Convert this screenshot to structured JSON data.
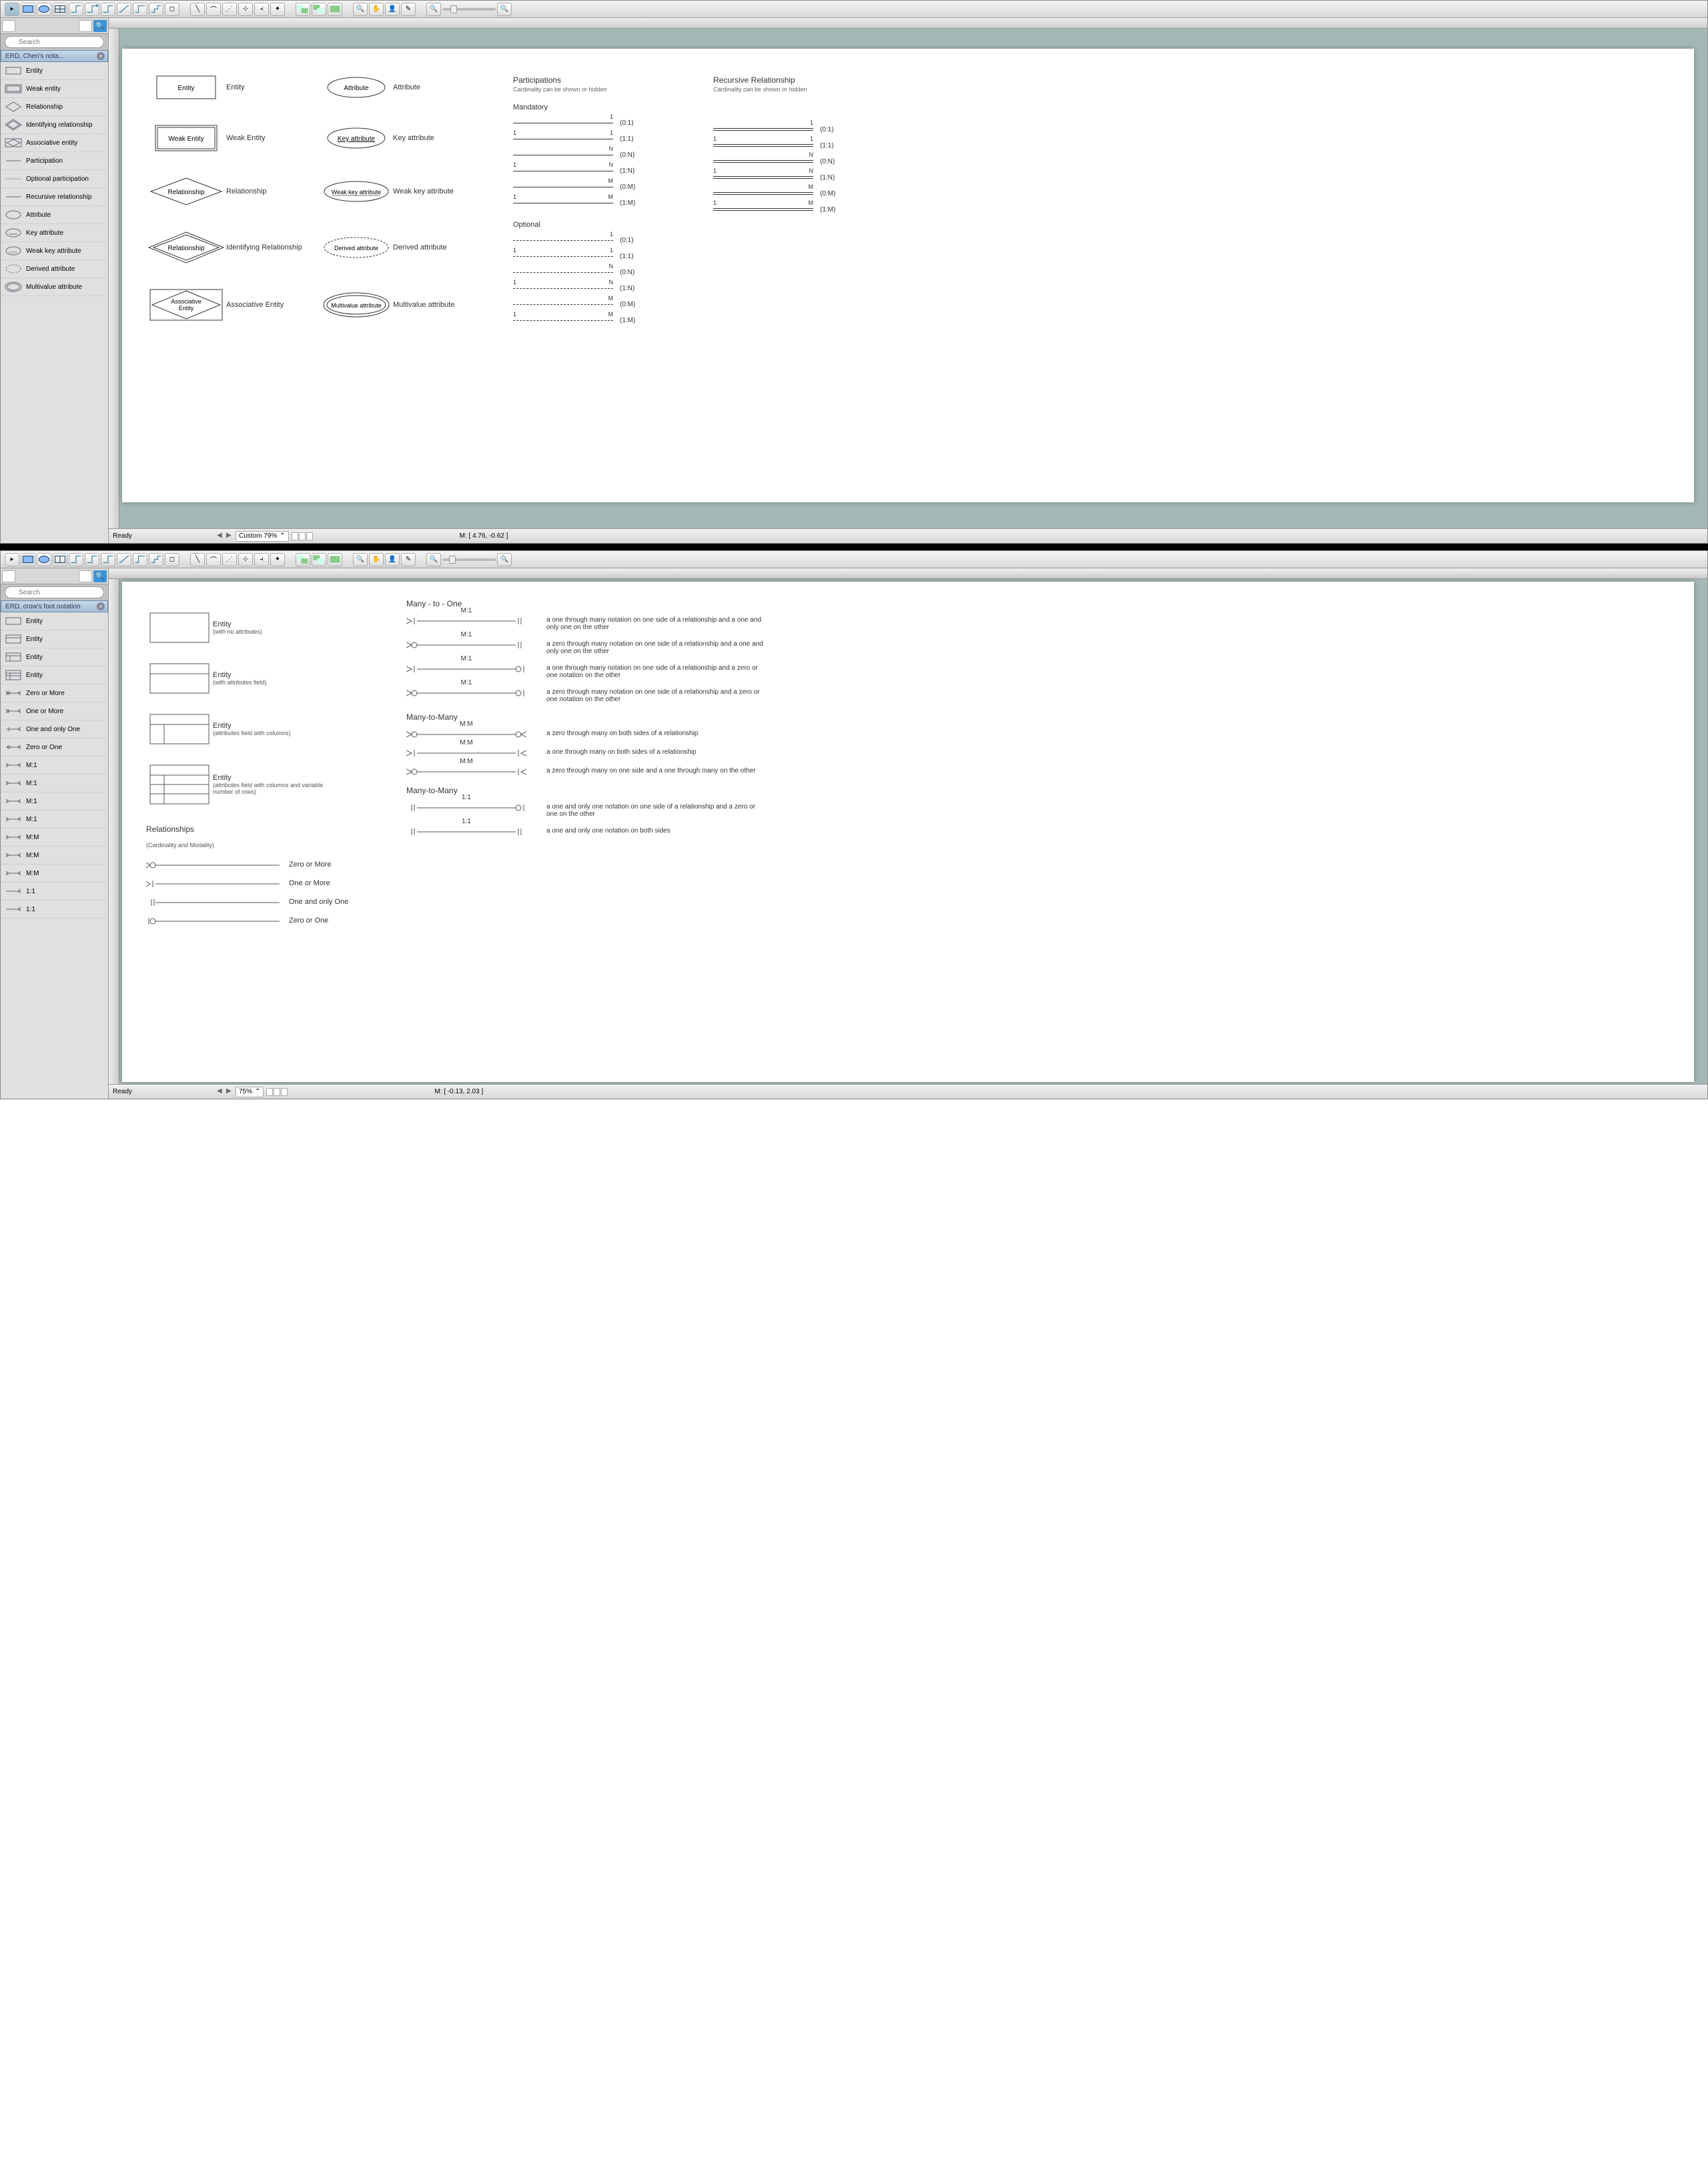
{
  "window1": {
    "search_placeholder": "Search",
    "library_title": "ERD, Chen's nota...",
    "library_items": [
      {
        "name": "Entity",
        "icon": "rect"
      },
      {
        "name": "Weak entity",
        "icon": "drect"
      },
      {
        "name": "Relationship",
        "icon": "diamond"
      },
      {
        "name": "Identifying relationship",
        "icon": "ddiamond"
      },
      {
        "name": "Associative entity",
        "icon": "assoc"
      },
      {
        "name": "Participation",
        "icon": "line"
      },
      {
        "name": "Optional participation",
        "icon": "dline"
      },
      {
        "name": "Recursive relationship",
        "icon": "line"
      },
      {
        "name": "Attribute",
        "icon": "ellipse"
      },
      {
        "name": "Key attribute",
        "icon": "ellipse-u"
      },
      {
        "name": "Weak key attribute",
        "icon": "ellipse-du"
      },
      {
        "name": "Derived attribute",
        "icon": "dellipse"
      },
      {
        "name": "Multivalue attribute",
        "icon": "dbl-ellipse"
      }
    ],
    "canvas": {
      "col1": [
        {
          "shape": "Entity",
          "label": "Entity"
        },
        {
          "shape": "Weak Entity",
          "label": "Weak Entity"
        },
        {
          "shape": "Relationship",
          "label": "Relationship"
        },
        {
          "shape": "Relationship",
          "label": "Identifying Relationship"
        },
        {
          "shape": "Associative Entity",
          "label": "Associative Entity"
        }
      ],
      "col2": [
        {
          "shape": "Attribute",
          "label": "Attribute"
        },
        {
          "shape": "Key attribute",
          "label": "Key attribute"
        },
        {
          "shape": "Weak key attribute",
          "label": "Weak key attribute"
        },
        {
          "shape": "Derived attribute",
          "label": "Derived attribute"
        },
        {
          "shape": "Multivalue attribute",
          "label": "Multivalue attribute"
        }
      ],
      "participations_hdr": "Participations",
      "participations_sub": "Cardinality can be shown or hidden",
      "recursive_hdr": "Recursive Relationship",
      "recursive_sub": "Cardinality can be shown or hidden",
      "mandatory_label": "Mandatory",
      "mandatory": [
        {
          "l": "",
          "r": "1",
          "c": "(0:1)"
        },
        {
          "l": "1",
          "r": "1",
          "c": "(1:1)"
        },
        {
          "l": "",
          "r": "N",
          "c": "(0:N)"
        },
        {
          "l": "1",
          "r": "N",
          "c": "(1:N)"
        },
        {
          "l": "",
          "r": "M",
          "c": "(0:M)"
        },
        {
          "l": "1",
          "r": "M",
          "c": "(1:M)"
        }
      ],
      "optional_label": "Optional",
      "optional": [
        {
          "l": "",
          "r": "1",
          "c": "(0:1)"
        },
        {
          "l": "1",
          "r": "1",
          "c": "(1:1)"
        },
        {
          "l": "",
          "r": "N",
          "c": "(0:N)"
        },
        {
          "l": "1",
          "r": "N",
          "c": "(1:N)"
        },
        {
          "l": "",
          "r": "M",
          "c": "(0:M)"
        },
        {
          "l": "1",
          "r": "M",
          "c": "(1:M)"
        }
      ]
    },
    "zoom_label": "Custom 79%",
    "mouse_pos": "M: [ 4.76, -0.62 ]",
    "status": "Ready"
  },
  "window2": {
    "search_placeholder": "Search",
    "library_title": "ERD, crow's foot notation",
    "library_items": [
      {
        "name": "Entity",
        "icon": "rect"
      },
      {
        "name": "Entity",
        "icon": "rect2"
      },
      {
        "name": "Entity",
        "icon": "rect3"
      },
      {
        "name": "Entity",
        "icon": "rect4"
      },
      {
        "name": "Zero or More",
        "icon": "cf-zm"
      },
      {
        "name": "One or More",
        "icon": "cf-om"
      },
      {
        "name": "One and only One",
        "icon": "cf-oo"
      },
      {
        "name": "Zero or One",
        "icon": "cf-zo"
      },
      {
        "name": "M:1",
        "icon": "cf-m1a"
      },
      {
        "name": "M:1",
        "icon": "cf-m1b"
      },
      {
        "name": "M:1",
        "icon": "cf-m1c"
      },
      {
        "name": "M:1",
        "icon": "cf-m1d"
      },
      {
        "name": "M:M",
        "icon": "cf-mma"
      },
      {
        "name": "M:M",
        "icon": "cf-mmb"
      },
      {
        "name": "M:M",
        "icon": "cf-mmc"
      },
      {
        "name": "1:1",
        "icon": "cf-11a"
      },
      {
        "name": "1:1",
        "icon": "cf-11b"
      }
    ],
    "canvas": {
      "entities": [
        {
          "title": "Entity",
          "sub": "(with no attributes)"
        },
        {
          "title": "Entity",
          "sub": "(with attributes field)"
        },
        {
          "title": "Entity",
          "sub": "(attributes field with columns)"
        },
        {
          "title": "Entity",
          "sub": "(attributes field with columns and variable number of rows)"
        }
      ],
      "rel_hdr": "Relationships",
      "rel_sub": "(Cardinality and Modality)",
      "basic_rels": [
        {
          "label": "Zero or More"
        },
        {
          "label": "One or More"
        },
        {
          "label": "One and only One"
        },
        {
          "label": "Zero or One"
        }
      ],
      "m1_hdr": "Many - to - One",
      "m1": [
        {
          "lbl": "M:1",
          "desc": "a one through many notation on one side of a relationship and a one and only one on the other"
        },
        {
          "lbl": "M:1",
          "desc": "a zero through many notation on one side of a relationship and a one and only one on the other"
        },
        {
          "lbl": "M:1",
          "desc": "a one through many notation on one side of a relationship and a zero or one notation on the other"
        },
        {
          "lbl": "M:1",
          "desc": "a zero through many notation on one side of a relationship and a zero or one notation on the other"
        }
      ],
      "mm_hdr": "Many-to-Many",
      "mm": [
        {
          "lbl": "M:M",
          "desc": "a zero through many on both sides of a relationship"
        },
        {
          "lbl": "M:M",
          "desc": "a one through many on both sides of a relationship"
        },
        {
          "lbl": "M:M",
          "desc": "a zero through many on one side and a one through many on the other"
        }
      ],
      "oo_hdr": "Many-to-Many",
      "oo": [
        {
          "lbl": "1:1",
          "desc": "a one and only one notation on one side of a relationship and a zero or one on the other"
        },
        {
          "lbl": "1:1",
          "desc": "a one and only one notation on both sides"
        }
      ]
    },
    "zoom_label": "75%",
    "mouse_pos": "M: [ -0.13, 2.03 ]",
    "status": "Ready"
  }
}
